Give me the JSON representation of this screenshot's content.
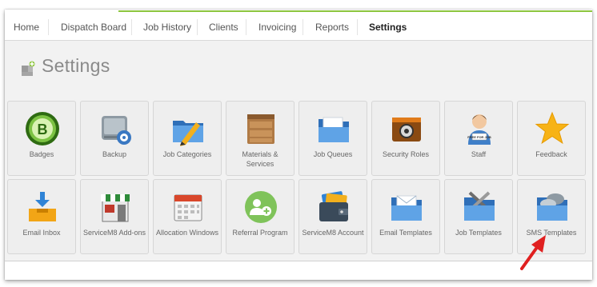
{
  "nav": {
    "items": [
      "Home",
      "Dispatch Board",
      "Job History",
      "Clients",
      "Invoicing",
      "Reports",
      "Settings"
    ],
    "active": "Settings"
  },
  "page": {
    "title": "Settings"
  },
  "tiles_row1": [
    {
      "label": "Badges",
      "icon": "badge-icon"
    },
    {
      "label": "Backup",
      "icon": "backup-icon"
    },
    {
      "label": "Job Categories",
      "icon": "folder-pencil-icon"
    },
    {
      "label": "Materials & Services",
      "icon": "crate-icon"
    },
    {
      "label": "Job Queues",
      "icon": "folder-icon"
    },
    {
      "label": "Security Roles",
      "icon": "safe-icon"
    },
    {
      "label": "Staff",
      "icon": "person-icon"
    },
    {
      "label": "Feedback",
      "icon": "star-icon"
    }
  ],
  "tiles_row2": [
    {
      "label": "Email Inbox",
      "icon": "inbox-icon"
    },
    {
      "label": "ServiceM8 Add-ons",
      "icon": "store-icon"
    },
    {
      "label": "Allocation Windows",
      "icon": "calendar-icon"
    },
    {
      "label": "Referral Program",
      "icon": "referral-icon"
    },
    {
      "label": "ServiceM8 Account",
      "icon": "wallet-icon"
    },
    {
      "label": "Email Templates",
      "icon": "folder-envelope-icon"
    },
    {
      "label": "Job Templates",
      "icon": "folder-tools-icon"
    },
    {
      "label": "SMS Templates",
      "icon": "folder-chat-icon"
    }
  ],
  "colors": {
    "accent": "#8dc63f",
    "arrow": "#e02020"
  }
}
